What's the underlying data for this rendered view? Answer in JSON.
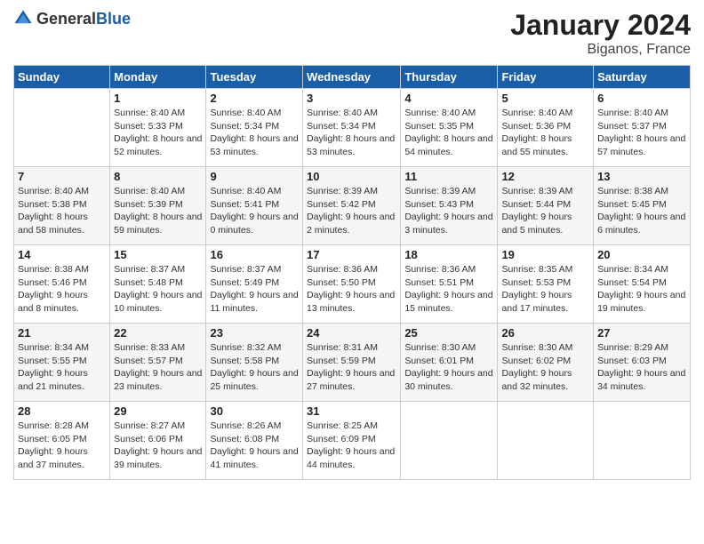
{
  "header": {
    "logo": {
      "general": "General",
      "blue": "Blue"
    },
    "title": "January 2024",
    "subtitle": "Biganos, France"
  },
  "calendar": {
    "days_of_week": [
      "Sunday",
      "Monday",
      "Tuesday",
      "Wednesday",
      "Thursday",
      "Friday",
      "Saturday"
    ],
    "weeks": [
      [
        {
          "day": null,
          "sunrise": null,
          "sunset": null,
          "daylight": null
        },
        {
          "day": "1",
          "sunrise": "Sunrise: 8:40 AM",
          "sunset": "Sunset: 5:33 PM",
          "daylight": "Daylight: 8 hours and 52 minutes."
        },
        {
          "day": "2",
          "sunrise": "Sunrise: 8:40 AM",
          "sunset": "Sunset: 5:34 PM",
          "daylight": "Daylight: 8 hours and 53 minutes."
        },
        {
          "day": "3",
          "sunrise": "Sunrise: 8:40 AM",
          "sunset": "Sunset: 5:34 PM",
          "daylight": "Daylight: 8 hours and 53 minutes."
        },
        {
          "day": "4",
          "sunrise": "Sunrise: 8:40 AM",
          "sunset": "Sunset: 5:35 PM",
          "daylight": "Daylight: 8 hours and 54 minutes."
        },
        {
          "day": "5",
          "sunrise": "Sunrise: 8:40 AM",
          "sunset": "Sunset: 5:36 PM",
          "daylight": "Daylight: 8 hours and 55 minutes."
        },
        {
          "day": "6",
          "sunrise": "Sunrise: 8:40 AM",
          "sunset": "Sunset: 5:37 PM",
          "daylight": "Daylight: 8 hours and 57 minutes."
        }
      ],
      [
        {
          "day": "7",
          "sunrise": "Sunrise: 8:40 AM",
          "sunset": "Sunset: 5:38 PM",
          "daylight": "Daylight: 8 hours and 58 minutes."
        },
        {
          "day": "8",
          "sunrise": "Sunrise: 8:40 AM",
          "sunset": "Sunset: 5:39 PM",
          "daylight": "Daylight: 8 hours and 59 minutes."
        },
        {
          "day": "9",
          "sunrise": "Sunrise: 8:40 AM",
          "sunset": "Sunset: 5:41 PM",
          "daylight": "Daylight: 9 hours and 0 minutes."
        },
        {
          "day": "10",
          "sunrise": "Sunrise: 8:39 AM",
          "sunset": "Sunset: 5:42 PM",
          "daylight": "Daylight: 9 hours and 2 minutes."
        },
        {
          "day": "11",
          "sunrise": "Sunrise: 8:39 AM",
          "sunset": "Sunset: 5:43 PM",
          "daylight": "Daylight: 9 hours and 3 minutes."
        },
        {
          "day": "12",
          "sunrise": "Sunrise: 8:39 AM",
          "sunset": "Sunset: 5:44 PM",
          "daylight": "Daylight: 9 hours and 5 minutes."
        },
        {
          "day": "13",
          "sunrise": "Sunrise: 8:38 AM",
          "sunset": "Sunset: 5:45 PM",
          "daylight": "Daylight: 9 hours and 6 minutes."
        }
      ],
      [
        {
          "day": "14",
          "sunrise": "Sunrise: 8:38 AM",
          "sunset": "Sunset: 5:46 PM",
          "daylight": "Daylight: 9 hours and 8 minutes."
        },
        {
          "day": "15",
          "sunrise": "Sunrise: 8:37 AM",
          "sunset": "Sunset: 5:48 PM",
          "daylight": "Daylight: 9 hours and 10 minutes."
        },
        {
          "day": "16",
          "sunrise": "Sunrise: 8:37 AM",
          "sunset": "Sunset: 5:49 PM",
          "daylight": "Daylight: 9 hours and 11 minutes."
        },
        {
          "day": "17",
          "sunrise": "Sunrise: 8:36 AM",
          "sunset": "Sunset: 5:50 PM",
          "daylight": "Daylight: 9 hours and 13 minutes."
        },
        {
          "day": "18",
          "sunrise": "Sunrise: 8:36 AM",
          "sunset": "Sunset: 5:51 PM",
          "daylight": "Daylight: 9 hours and 15 minutes."
        },
        {
          "day": "19",
          "sunrise": "Sunrise: 8:35 AM",
          "sunset": "Sunset: 5:53 PM",
          "daylight": "Daylight: 9 hours and 17 minutes."
        },
        {
          "day": "20",
          "sunrise": "Sunrise: 8:34 AM",
          "sunset": "Sunset: 5:54 PM",
          "daylight": "Daylight: 9 hours and 19 minutes."
        }
      ],
      [
        {
          "day": "21",
          "sunrise": "Sunrise: 8:34 AM",
          "sunset": "Sunset: 5:55 PM",
          "daylight": "Daylight: 9 hours and 21 minutes."
        },
        {
          "day": "22",
          "sunrise": "Sunrise: 8:33 AM",
          "sunset": "Sunset: 5:57 PM",
          "daylight": "Daylight: 9 hours and 23 minutes."
        },
        {
          "day": "23",
          "sunrise": "Sunrise: 8:32 AM",
          "sunset": "Sunset: 5:58 PM",
          "daylight": "Daylight: 9 hours and 25 minutes."
        },
        {
          "day": "24",
          "sunrise": "Sunrise: 8:31 AM",
          "sunset": "Sunset: 5:59 PM",
          "daylight": "Daylight: 9 hours and 27 minutes."
        },
        {
          "day": "25",
          "sunrise": "Sunrise: 8:30 AM",
          "sunset": "Sunset: 6:01 PM",
          "daylight": "Daylight: 9 hours and 30 minutes."
        },
        {
          "day": "26",
          "sunrise": "Sunrise: 8:30 AM",
          "sunset": "Sunset: 6:02 PM",
          "daylight": "Daylight: 9 hours and 32 minutes."
        },
        {
          "day": "27",
          "sunrise": "Sunrise: 8:29 AM",
          "sunset": "Sunset: 6:03 PM",
          "daylight": "Daylight: 9 hours and 34 minutes."
        }
      ],
      [
        {
          "day": "28",
          "sunrise": "Sunrise: 8:28 AM",
          "sunset": "Sunset: 6:05 PM",
          "daylight": "Daylight: 9 hours and 37 minutes."
        },
        {
          "day": "29",
          "sunrise": "Sunrise: 8:27 AM",
          "sunset": "Sunset: 6:06 PM",
          "daylight": "Daylight: 9 hours and 39 minutes."
        },
        {
          "day": "30",
          "sunrise": "Sunrise: 8:26 AM",
          "sunset": "Sunset: 6:08 PM",
          "daylight": "Daylight: 9 hours and 41 minutes."
        },
        {
          "day": "31",
          "sunrise": "Sunrise: 8:25 AM",
          "sunset": "Sunset: 6:09 PM",
          "daylight": "Daylight: 9 hours and 44 minutes."
        },
        {
          "day": null,
          "sunrise": null,
          "sunset": null,
          "daylight": null
        },
        {
          "day": null,
          "sunrise": null,
          "sunset": null,
          "daylight": null
        },
        {
          "day": null,
          "sunrise": null,
          "sunset": null,
          "daylight": null
        }
      ]
    ]
  }
}
